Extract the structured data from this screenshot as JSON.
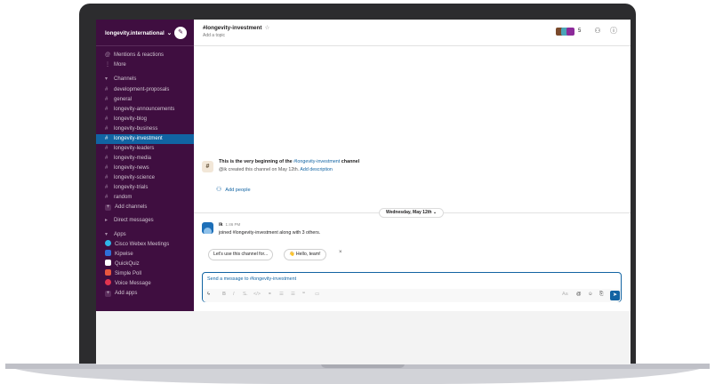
{
  "workspace": {
    "name": "longevity.international",
    "caret": "⌄",
    "compose_icon": "edit-icon"
  },
  "sidebar": {
    "mentions": "Mentions & reactions",
    "more": "More",
    "channels_header": "Channels",
    "channels": [
      "development-proposals",
      "general",
      "longevity-announcements",
      "longevity-blog",
      "longevity-business",
      "longevity-investment",
      "longevity-leaders",
      "longevity-media",
      "longevity-news",
      "longevity-science",
      "longevity-trials",
      "random"
    ],
    "active_channel_index": 5,
    "add_channels": "Add channels",
    "direct_messages_header": "Direct messages",
    "apps_header": "Apps",
    "apps": [
      {
        "label": "Cisco Webex Meetings",
        "color": "#2fb5e8"
      },
      {
        "label": "Kipwise",
        "color": "#2e6fd9"
      },
      {
        "label": "QuickQuiz",
        "color": "#ffffff"
      },
      {
        "label": "Simple Poll",
        "color": "#e8573f"
      },
      {
        "label": "Voice Message",
        "color": "#e2344f"
      }
    ],
    "add_apps": "Add apps"
  },
  "channel": {
    "name": "#longevity-investment",
    "star": "☆",
    "topic": "Add a topic",
    "member_count": "5"
  },
  "intro": {
    "title_prefix": "This is the very beginning of the ",
    "title_channel": "#longevity-investment",
    "title_suffix": " channel",
    "sub_prefix": "@ik created this channel on May 12th. ",
    "sub_link": "Add description",
    "add_people": "Add people"
  },
  "divider": {
    "date": "Wednesday, May 12th ⌄"
  },
  "message": {
    "author": "ik",
    "time": "1:46 PM",
    "text": "joined #longevity-investment along with 3 others."
  },
  "suggestions": {
    "chip1": "Let's use this channel for...",
    "chip2": "👋 Hello, team!",
    "close": "×"
  },
  "composer": {
    "placeholder": "Send a message to #longevity-investment",
    "aa": "Aa",
    "send": "➤"
  },
  "colors": {
    "sidebar_bg": "#3f0e40",
    "active_channel": "#1164a3",
    "link": "#1264a3"
  }
}
